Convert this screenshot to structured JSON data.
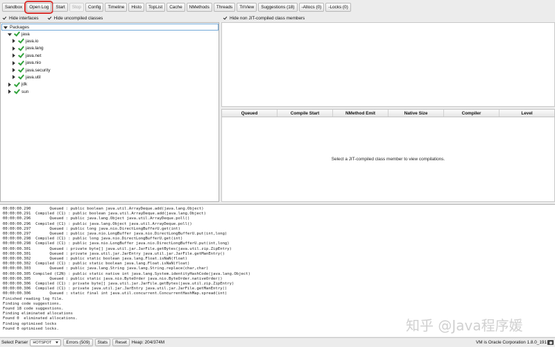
{
  "toolbar": {
    "buttons": [
      {
        "label": "Sandbox",
        "state": "normal"
      },
      {
        "label": "Open Log",
        "state": "highlight"
      },
      {
        "label": "Start",
        "state": "normal"
      },
      {
        "label": "Stop",
        "state": "disabled"
      },
      {
        "label": "Config",
        "state": "normal"
      },
      {
        "label": "Timeline",
        "state": "normal"
      },
      {
        "label": "Histo",
        "state": "normal"
      },
      {
        "label": "TopList",
        "state": "normal"
      },
      {
        "label": "Cache",
        "state": "normal"
      },
      {
        "label": "NMethods",
        "state": "normal"
      },
      {
        "label": "Threads",
        "state": "normal"
      },
      {
        "label": "TriView",
        "state": "normal"
      },
      {
        "label": "Suggestions (18)",
        "state": "normal"
      },
      {
        "label": "-Allocs (0)",
        "state": "normal"
      },
      {
        "label": "-Locks (0)",
        "state": "normal"
      }
    ]
  },
  "filters": {
    "hide_interfaces": "Hide interfaces",
    "hide_uncompiled": "Hide uncompiled classes",
    "hide_non_jit": "Hide non JIT-compiled class members"
  },
  "tree": {
    "root": "Packages",
    "nodes": [
      {
        "label": "java",
        "level": 1,
        "expanded": true
      },
      {
        "label": "java.io",
        "level": 2,
        "expanded": false
      },
      {
        "label": "java.lang",
        "level": 2,
        "expanded": false
      },
      {
        "label": "java.net",
        "level": 2,
        "expanded": false
      },
      {
        "label": "java.nio",
        "level": 2,
        "expanded": false
      },
      {
        "label": "java.security",
        "level": 2,
        "expanded": false
      },
      {
        "label": "java.util",
        "level": 2,
        "expanded": false
      },
      {
        "label": "jdk",
        "level": 1,
        "expanded": false
      },
      {
        "label": "sun",
        "level": 1,
        "expanded": false
      }
    ]
  },
  "compilations": {
    "columns": [
      "Queued",
      "Compile Start",
      "NMethod Emit",
      "Native Size",
      "Compiler",
      "Level"
    ],
    "empty_message": "Select a JIT-compiled class member to view compilations."
  },
  "log": {
    "lines": [
      "00:00:00.290        Queued : public boolean java.util.ArrayDeque.add(java.lang.Object)",
      "00:00:00.291  Compiled (C1) : public boolean java.util.ArrayDeque.add(java.lang.Object)",
      "00:00:00.296        Queued : public java.lang.Object java.util.ArrayDeque.poll()",
      "00:00:00.296  Compiled (C1) : public java.lang.Object java.util.ArrayDeque.poll()",
      "00:00:00.297        Queued : public long java.nio.DirectLongBufferU.get(int)",
      "00:00:00.297        Queued : public java.nio.LongBuffer java.nio.DirectLongBufferU.put(int,long)",
      "00:00:00.298  Compiled (C1) : public long java.nio.DirectLongBufferU.get(int)",
      "00:00:00.298  Compiled (C1) : public java.nio.LongBuffer java.nio.DirectLongBufferU.put(int,long)",
      "00:00:00.301        Queued : private byte[] java.util.jar.JarFile.getBytes(java.util.zip.ZipEntry)",
      "00:00:00.301        Queued : private java.util.jar.JarEntry java.util.jar.JarFile.getManEntry()",
      "00:00:00.302        Queued : public static boolean java.lang.Float.isNaN(float)",
      "00:00:00.302  Compiled (C1) : public static boolean java.lang.Float.isNaN(float)",
      "00:00:00.303        Queued : public java.lang.String java.lang.String.replace(char,char)",
      "00:00:00.305 Compiled (C2N) : public static native int java.lang.System.identityHashCode(java.lang.Object)",
      "00:00:00.305        Queued : public static java.nio.ByteOrder java.nio.ByteOrder.nativeOrder()",
      "00:00:00.306  Compiled (C1) : private byte[] java.util.jar.JarFile.getBytes(java.util.zip.ZipEntry)",
      "00:00:00.306  Compiled (C1) : private java.util.jar.JarEntry java.util.jar.JarFile.getManEntry()",
      "00:00:00.306        Queued : static final int java.util.concurrent.ConcurrentHashMap.spread(int)",
      "Finished reading log file.",
      "Finding code suggestions.",
      "Found 18 code suggestions.",
      "Finding eliminated allocations",
      "Found 0  eliminated allocations.",
      "Finding optimised locks",
      "Found 0 optimised locks."
    ],
    "watermark": "知乎 @Java程序媛"
  },
  "statusbar": {
    "parser_label": "Select Parser",
    "parser_value": "HOTSPOT",
    "errors_label": "Errors (509)",
    "stats_label": "Stats",
    "reset_label": "Reset",
    "heap": "Heap: 204/374M",
    "vm_info": "VM is Oracle Corporation 1.8.0_191"
  }
}
